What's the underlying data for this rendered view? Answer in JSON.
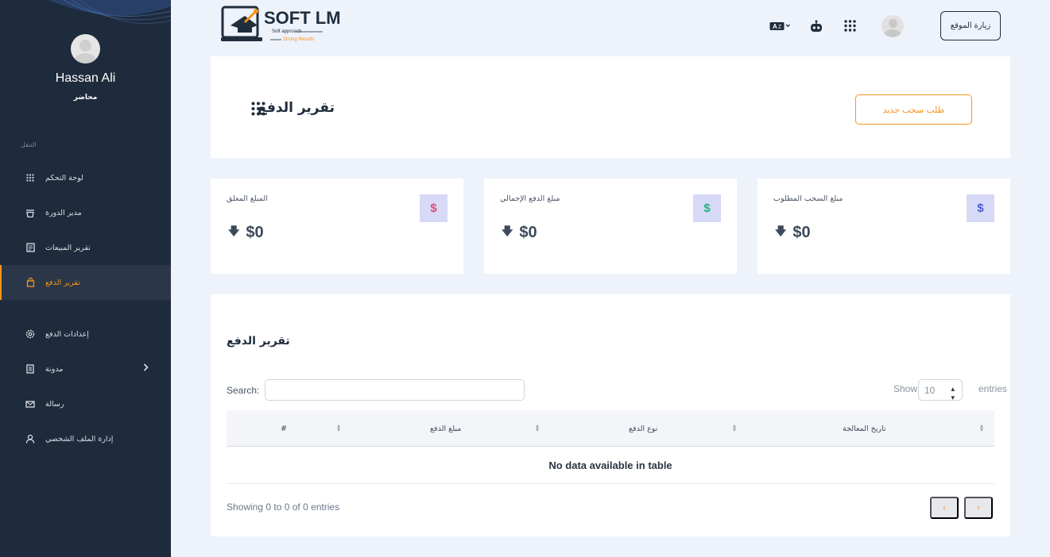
{
  "sidebar": {
    "user_name": "Hassan Ali",
    "user_role": "محاضر",
    "nav_caption": "التنقل",
    "items": [
      {
        "label": "لوحة التحكم",
        "icon": "grid-icon"
      },
      {
        "label": "مدير الدورة",
        "icon": "stack-icon"
      },
      {
        "label": "تقرير المبيعات",
        "icon": "report-icon"
      },
      {
        "label": "تقرير الدفع",
        "icon": "bag-icon",
        "active": true
      },
      {
        "label": "إعدادات الدفع",
        "icon": "settings-icon"
      },
      {
        "label": "مدونة",
        "icon": "document-icon"
      },
      {
        "label": "رسالة",
        "icon": "mail-icon"
      },
      {
        "label": "إدارة الملف الشخصي",
        "icon": "user-icon"
      }
    ]
  },
  "topbar": {
    "visit_site": "زيارة الموقع",
    "logo_text": "SOFT LMS",
    "logo_sub1": "Soft approach",
    "logo_sub2": "Strong Results"
  },
  "header": {
    "title": "تقرير الدفع",
    "withdraw_button": "طلب سحب جديد"
  },
  "stats": [
    {
      "label": "مبلغ السحب المطلوب",
      "value": "$0",
      "accent": "#4f5bd5"
    },
    {
      "label": "مبلغ الدفع الإجمالي",
      "value": "$0",
      "accent": "#1fb57a"
    },
    {
      "label": "المبلغ المعلق",
      "value": "$0",
      "accent": "#e8467c"
    }
  ],
  "table": {
    "title": "تقرير الدفع",
    "search_label": "Search:",
    "show_label": "Show",
    "entries_value": "10",
    "entries_label": "entries",
    "columns": [
      "تاريخ المعالجة",
      "نوع الدفع",
      "مبلغ الدفع",
      "#"
    ],
    "empty_message": "No data available in table",
    "showing": "Showing 0 to 0 of 0 entries",
    "next_symbol": "›",
    "prev_symbol": "‹"
  },
  "colors": {
    "sidebar_bg": "#1e2b3c",
    "accent": "#f7941d",
    "page_bg": "#eef2fb"
  }
}
